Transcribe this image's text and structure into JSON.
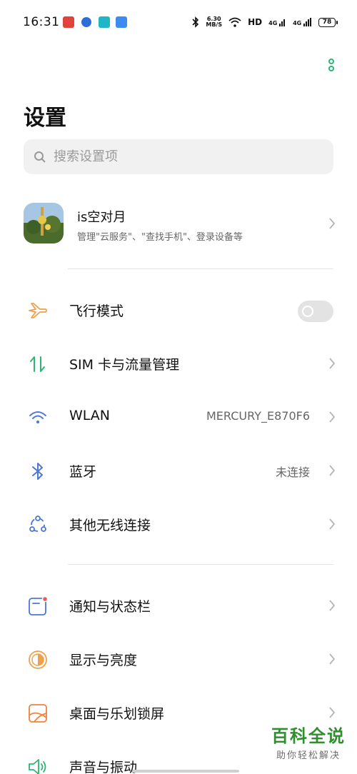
{
  "status_bar": {
    "time": "16:31",
    "speed_value": "6.30",
    "speed_unit": "MB/S",
    "hd_label": "HD",
    "signal_1": "4G",
    "signal_2": "4G",
    "battery": "78"
  },
  "header": {
    "title": "设置",
    "search_placeholder": "搜索设置项"
  },
  "account": {
    "name": "is空对月",
    "description": "管理\"云服务\"、\"查找手机\"、登录设备等"
  },
  "settings": {
    "airplane": {
      "label": "飞行模式",
      "icon": "airplane-icon",
      "toggle_on": false
    },
    "sim": {
      "label": "SIM 卡与流量管理",
      "icon": "sim-data-icon"
    },
    "wlan": {
      "label": "WLAN",
      "value": "MERCURY_E870F6",
      "icon": "wifi-icon"
    },
    "bluetooth": {
      "label": "蓝牙",
      "value": "未连接",
      "icon": "bluetooth-icon"
    },
    "other_wireless": {
      "label": "其他无线连接",
      "icon": "connections-icon"
    },
    "notifications": {
      "label": "通知与状态栏",
      "icon": "notification-icon"
    },
    "display": {
      "label": "显示与亮度",
      "icon": "brightness-icon"
    },
    "desktop": {
      "label": "桌面与乐划锁屏",
      "icon": "wallpaper-icon"
    },
    "sound": {
      "label": "声音与振动",
      "icon": "speaker-icon"
    }
  },
  "watermark": {
    "title": "百科全说",
    "subtitle": "助你轻松解决"
  },
  "colors": {
    "accent_green": "#2cb673",
    "orange": "#f0a04b",
    "blue": "#4a78d6",
    "red_badge": "#e45b5b"
  }
}
